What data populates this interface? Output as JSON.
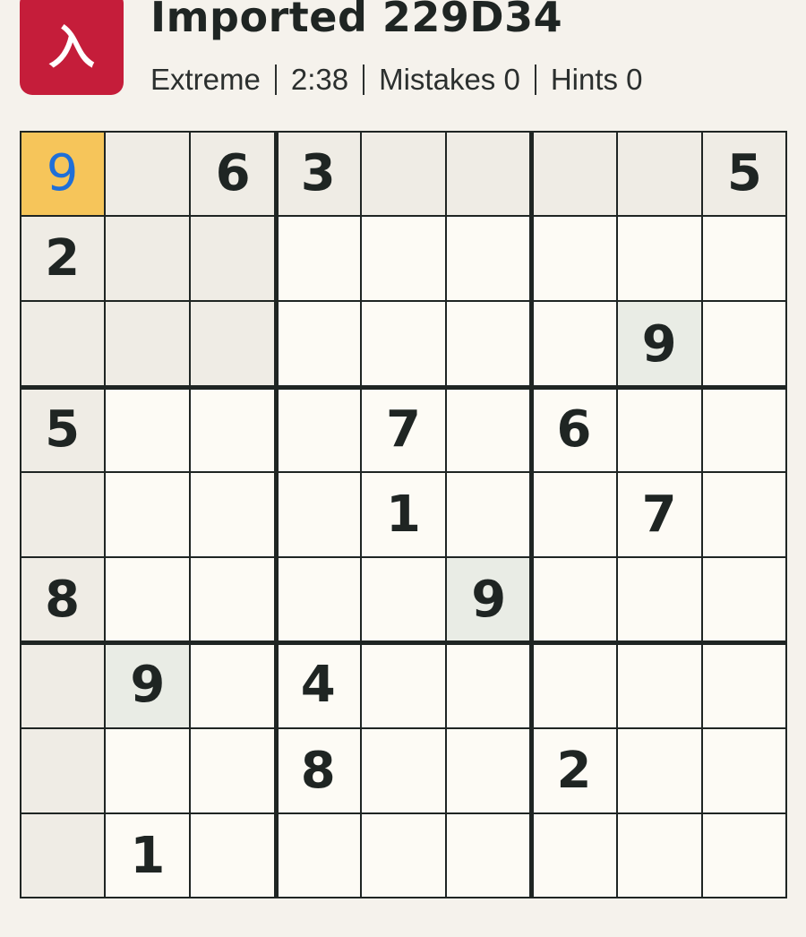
{
  "app": {
    "logo_glyph": "入",
    "title": "Imported 229D34",
    "difficulty": "Extreme",
    "timer": "2:38",
    "mistakes_label": "Mistakes 0",
    "hints_label": "Hints 0"
  },
  "colors": {
    "brand": "#c51d3a",
    "selected_cell": "#f6c55a",
    "peer_highlight": "#efece5",
    "same_value_highlight": "#e9ece5",
    "entered_digit": "#1f6fd8",
    "given_digit": "#1f2523"
  },
  "board": {
    "selected": [
      0,
      0
    ],
    "highlight_value": 9,
    "rows": [
      [
        "9",
        "",
        "6",
        "3",
        "",
        "",
        "",
        "",
        "5"
      ],
      [
        "2",
        "",
        "",
        "",
        "",
        "",
        "",
        "",
        ""
      ],
      [
        "",
        "",
        "",
        "",
        "",
        "",
        "",
        "9",
        ""
      ],
      [
        "5",
        "",
        "",
        "",
        "7",
        "",
        "6",
        "",
        ""
      ],
      [
        "",
        "",
        "",
        "",
        "1",
        "",
        "",
        "7",
        ""
      ],
      [
        "8",
        "",
        "",
        "",
        "",
        "9",
        "",
        "",
        ""
      ],
      [
        "",
        "9",
        "",
        "4",
        "",
        "",
        "",
        "",
        ""
      ],
      [
        "",
        "",
        "",
        "8",
        "",
        "",
        "2",
        "",
        ""
      ],
      [
        "",
        "1",
        "",
        "",
        "",
        "",
        "",
        "",
        ""
      ]
    ]
  }
}
